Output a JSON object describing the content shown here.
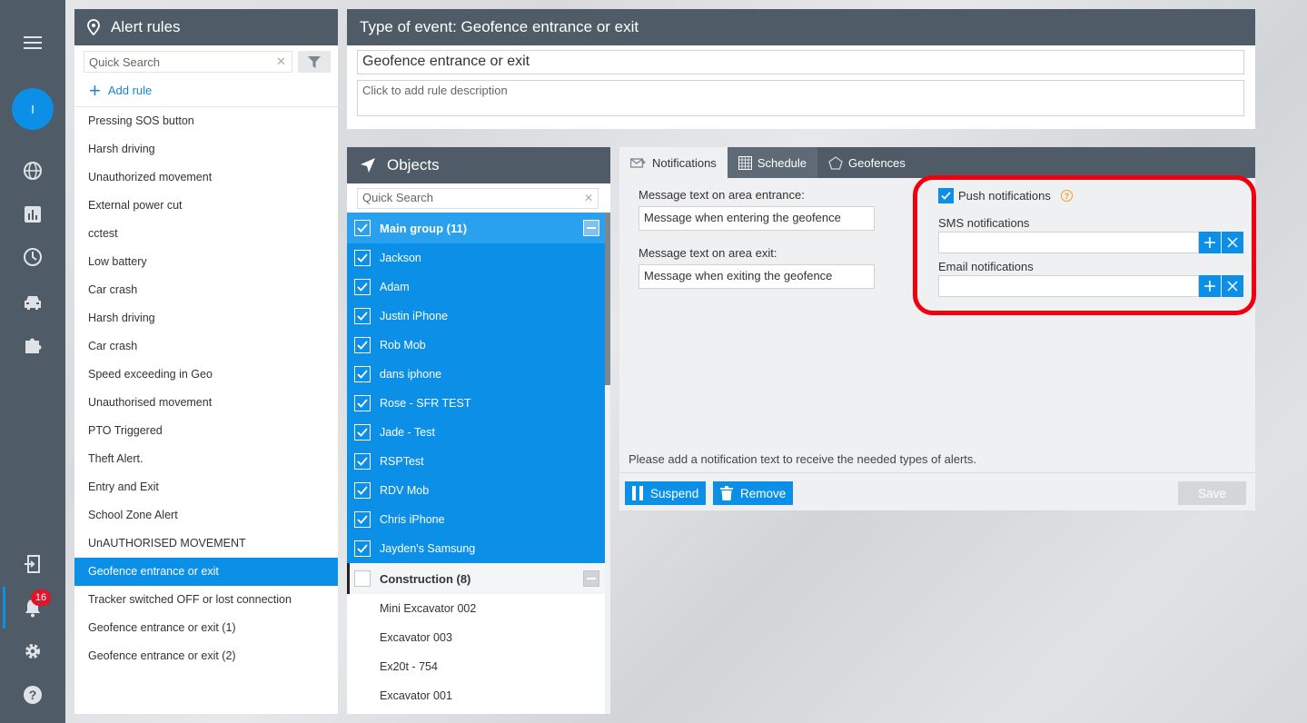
{
  "rail": {
    "avatar_letter": "I",
    "notification_count": "16",
    "icons": [
      "menu-icon",
      "globe-icon",
      "chart-icon",
      "clock-icon",
      "car-icon",
      "puzzle-icon",
      "logout-icon",
      "bell-icon",
      "gear-icon",
      "help-icon"
    ]
  },
  "rules_panel": {
    "title": "Alert rules",
    "search_placeholder": "Quick Search",
    "add_rule_label": "Add rule",
    "items": [
      "Pressing SOS button",
      "Harsh driving",
      "Unauthorized movement",
      "External power cut",
      "cctest",
      "Low battery",
      "Car crash",
      "Harsh driving",
      "Car crash",
      "Speed exceeding in Geo",
      "Unauthorised movement",
      "PTO Triggered",
      "Theft Alert.",
      "Entry and Exit",
      "School Zone Alert",
      "UnAUTHORISED MOVEMENT",
      "Geofence entrance or exit",
      "Tracker switched OFF or lost connection",
      "Geofence entrance or exit (1)",
      "Geofence entrance or exit (2)"
    ],
    "active_index": 16
  },
  "event_panel": {
    "title": "Type of event: Geofence entrance or exit",
    "rule_name": "Geofence entrance or exit",
    "description_placeholder": "Click to add rule description"
  },
  "objects_panel": {
    "title": "Objects",
    "search_placeholder": "Quick Search",
    "group1": {
      "label": "Main group (11)",
      "items": [
        "Jackson",
        "Adam",
        "Justin iPhone",
        "Rob Mob",
        "dans iphone",
        "Rose - SFR TEST",
        "Jade - Test",
        "RSPTest",
        "RDV Mob",
        "Chris iPhone",
        "Jayden's Samsung"
      ]
    },
    "group2": {
      "label": "Construction (8)",
      "items": [
        "Mini Excavator 002",
        "Excavator 003",
        "Ex20t - 754",
        "Excavator 001"
      ]
    }
  },
  "notif_panel": {
    "tabs": [
      "Notifications",
      "Schedule",
      "Geofences"
    ],
    "entrance_label": "Message text on area entrance:",
    "entrance_value": "Message when entering the geofence",
    "exit_label": "Message text on area exit:",
    "exit_value": "Message when exiting the geofence",
    "push_label": "Push notifications",
    "sms_label": "SMS notifications",
    "email_label": "Email notifications",
    "hint": "Please add a notification text to receive the needed types of alerts.",
    "suspend_label": "Suspend",
    "remove_label": "Remove",
    "save_label": "Save"
  },
  "colors": {
    "accent": "#0c8fe6",
    "header": "#4f5b66",
    "highlight_box": "#f0000f"
  }
}
